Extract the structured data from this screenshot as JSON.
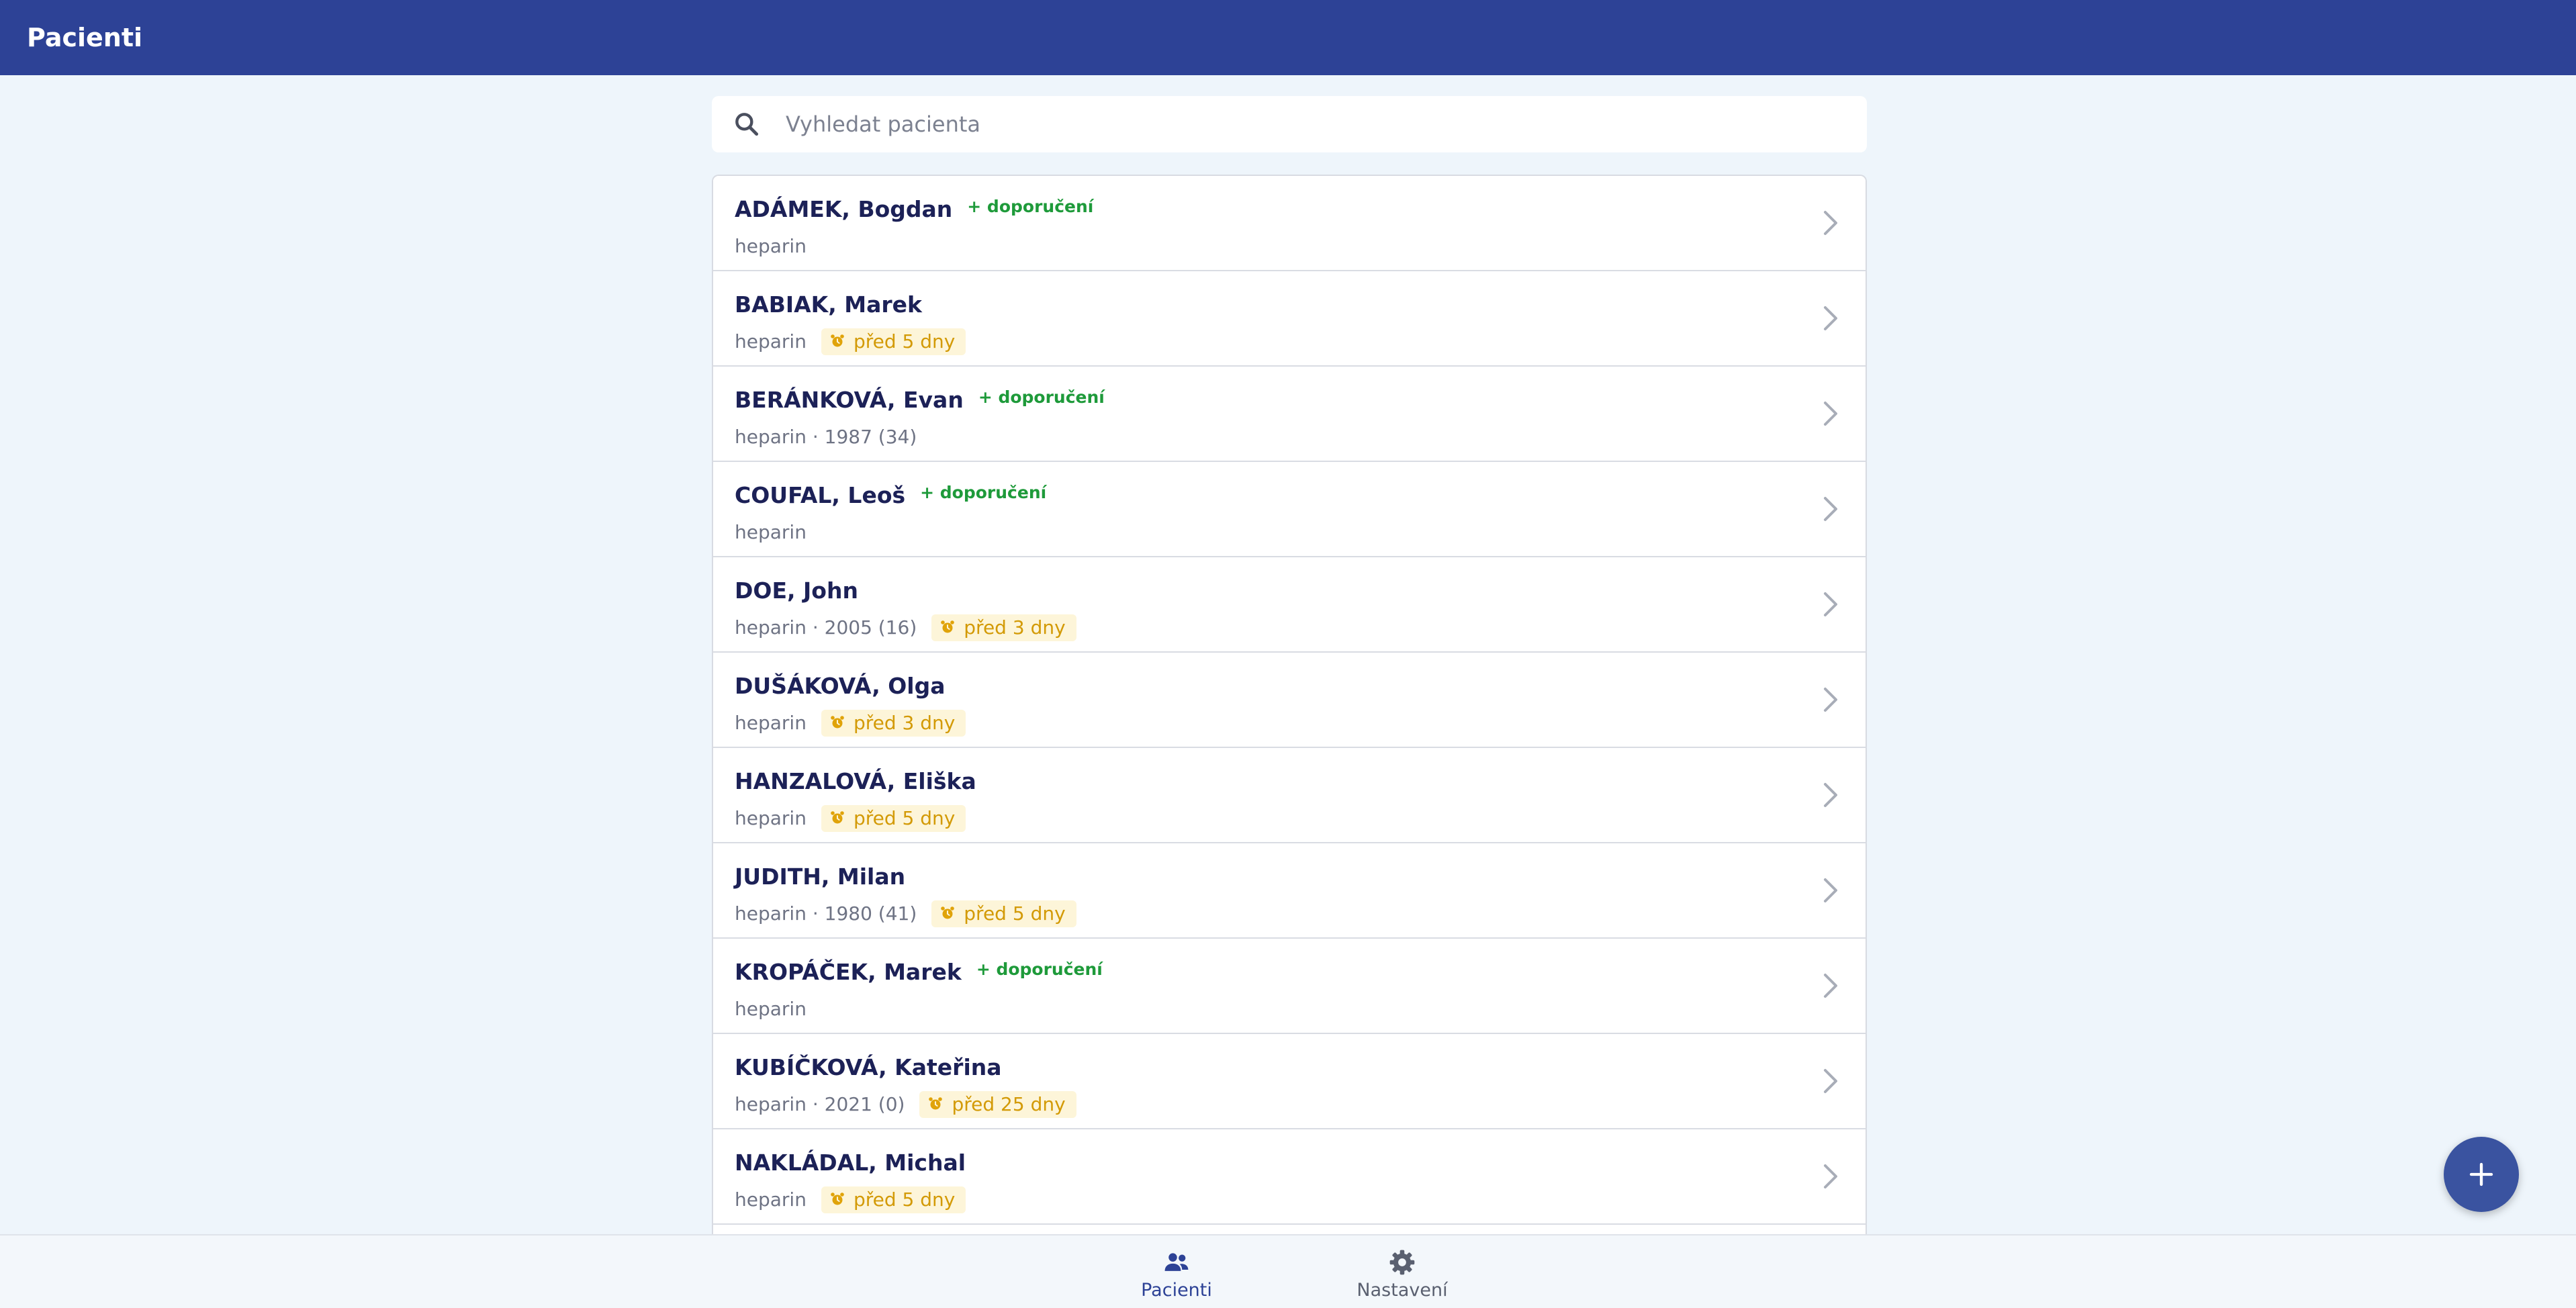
{
  "header": {
    "title": "Pacienti"
  },
  "search": {
    "placeholder": "Vyhledat pacienta",
    "value": ""
  },
  "patients": [
    {
      "name": "ADÁMEK, Bogdan",
      "referral": "+ doporučení",
      "details": "heparin",
      "badge": null
    },
    {
      "name": "BABIAK, Marek",
      "referral": null,
      "details": "heparin",
      "badge": "před 5 dny"
    },
    {
      "name": "BERÁNKOVÁ, Evan",
      "referral": "+ doporučení",
      "details": "heparin · 1987 (34)",
      "badge": null
    },
    {
      "name": "COUFAL, Leoš",
      "referral": "+ doporučení",
      "details": "heparin",
      "badge": null
    },
    {
      "name": "DOE, John",
      "referral": null,
      "details": "heparin · 2005 (16)",
      "badge": "před 3 dny"
    },
    {
      "name": "DUŠÁKOVÁ, Olga",
      "referral": null,
      "details": "heparin",
      "badge": "před 3 dny"
    },
    {
      "name": "HANZALOVÁ, Eliška",
      "referral": null,
      "details": "heparin",
      "badge": "před 5 dny"
    },
    {
      "name": "JUDITH, Milan",
      "referral": null,
      "details": "heparin · 1980 (41)",
      "badge": "před 5 dny"
    },
    {
      "name": "KROPÁČEK, Marek",
      "referral": "+ doporučení",
      "details": "heparin",
      "badge": null
    },
    {
      "name": "KUBÍČKOVÁ, Kateřina",
      "referral": null,
      "details": "heparin · 2021 (0)",
      "badge": "před 25 dny"
    },
    {
      "name": "NAKLÁDAL, Michal",
      "referral": null,
      "details": "heparin",
      "badge": "před 5 dny"
    }
  ],
  "bottom_nav": {
    "items": [
      {
        "label": "Pacienti",
        "icon": "people-icon",
        "active": true
      },
      {
        "label": "Nastavení",
        "icon": "gear-icon",
        "active": false
      }
    ]
  },
  "fab": {
    "icon": "plus-icon"
  },
  "colors": {
    "header": "#2d4296",
    "name": "#1c2157",
    "referral": "#1e9a3a",
    "badge_text": "#d39a06",
    "badge_bg": "#fdf5d9",
    "nav_active": "#2d4296",
    "nav_inactive": "#5a6070"
  }
}
